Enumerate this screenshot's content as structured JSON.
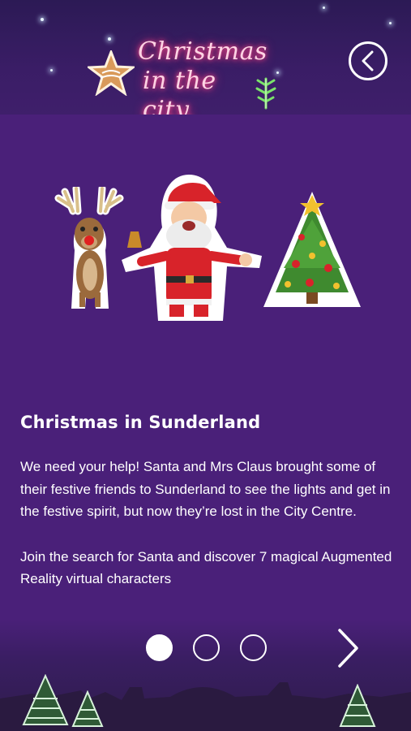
{
  "header": {
    "logo_line1": "Christmas",
    "logo_line2": "in the city."
  },
  "content": {
    "title": "Christmas in Sunderland",
    "paragraph1": "We need your help! Santa and Mrs Claus brought some of their festive friends to Sunderland to see the lights and get in the festive spirit, but now they’re lost in the City Centre.",
    "paragraph2": "Join the search for Santa and discover 7 magical Augmented Reality virtual characters"
  },
  "pagination": {
    "total": 3,
    "active_index": 0
  },
  "icons": {
    "back": "chevron-left-circle-icon",
    "next": "chevron-right-icon"
  },
  "colors": {
    "background": "#4a2079",
    "header": "#3a1d66",
    "neon_pink": "#ff4f8c"
  }
}
